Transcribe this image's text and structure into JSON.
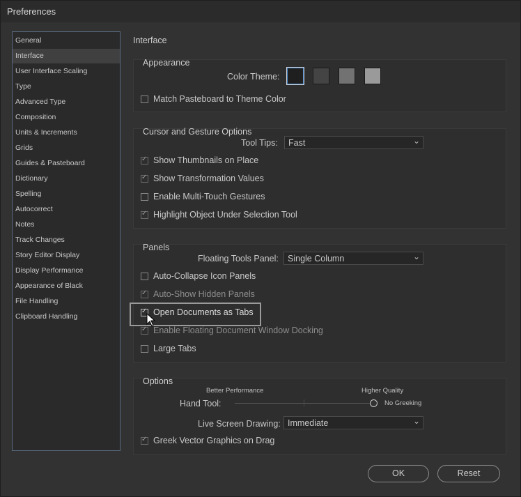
{
  "window": {
    "title": "Preferences"
  },
  "sidebar": {
    "items": [
      {
        "label": "General"
      },
      {
        "label": "Interface"
      },
      {
        "label": "User Interface Scaling"
      },
      {
        "label": "Type"
      },
      {
        "label": "Advanced Type"
      },
      {
        "label": "Composition"
      },
      {
        "label": "Units & Increments"
      },
      {
        "label": "Grids"
      },
      {
        "label": "Guides & Pasteboard"
      },
      {
        "label": "Dictionary"
      },
      {
        "label": "Spelling"
      },
      {
        "label": "Autocorrect"
      },
      {
        "label": "Notes"
      },
      {
        "label": "Track Changes"
      },
      {
        "label": "Story Editor Display"
      },
      {
        "label": "Display Performance"
      },
      {
        "label": "Appearance of Black"
      },
      {
        "label": "File Handling"
      },
      {
        "label": "Clipboard Handling"
      }
    ],
    "selected": "Interface"
  },
  "main": {
    "title": "Interface",
    "appearance": {
      "title": "Appearance",
      "color_theme_label": "Color Theme:",
      "themes": [
        {
          "color": "#1f1f1f",
          "selected": true
        },
        {
          "color": "#444444",
          "selected": false
        },
        {
          "color": "#727272",
          "selected": false
        },
        {
          "color": "#9a9a9a",
          "selected": false
        }
      ],
      "match_pasteboard": {
        "label": "Match Pasteboard to Theme Color",
        "checked": false
      }
    },
    "cursor": {
      "title": "Cursor and Gesture Options",
      "tool_tips_label": "Tool Tips:",
      "tool_tips_value": "Fast",
      "thumbnails": {
        "label": "Show Thumbnails on Place",
        "checked": true
      },
      "transformation": {
        "label": "Show Transformation Values",
        "checked": true
      },
      "multitouch": {
        "label": "Enable Multi-Touch Gestures",
        "checked": false
      },
      "highlight": {
        "label": "Highlight Object Under Selection Tool",
        "checked": true
      }
    },
    "panels": {
      "title": "Panels",
      "floating_label": "Floating Tools Panel:",
      "floating_value": "Single Column",
      "auto_collapse": {
        "label": "Auto-Collapse Icon Panels",
        "checked": false
      },
      "auto_show": {
        "label": "Auto-Show Hidden Panels",
        "checked": true
      },
      "open_tabs": {
        "label": "Open Documents as Tabs",
        "checked": true
      },
      "floating_docking": {
        "label": "Enable Floating Document Window Docking",
        "checked": true
      },
      "large_tabs": {
        "label": "Large Tabs",
        "checked": false
      }
    },
    "options": {
      "title": "Options",
      "better_performance": "Better Performance",
      "higher_quality": "Higher Quality",
      "hand_tool_label": "Hand Tool:",
      "no_greeking": "No Greeking",
      "hand_tool_level": 1.0,
      "live_drawing_label": "Live Screen Drawing:",
      "live_drawing_value": "Immediate",
      "greek_vector": {
        "label": "Greek Vector Graphics on Drag",
        "checked": true
      }
    }
  },
  "buttons": {
    "ok": "OK",
    "reset": "Reset"
  }
}
